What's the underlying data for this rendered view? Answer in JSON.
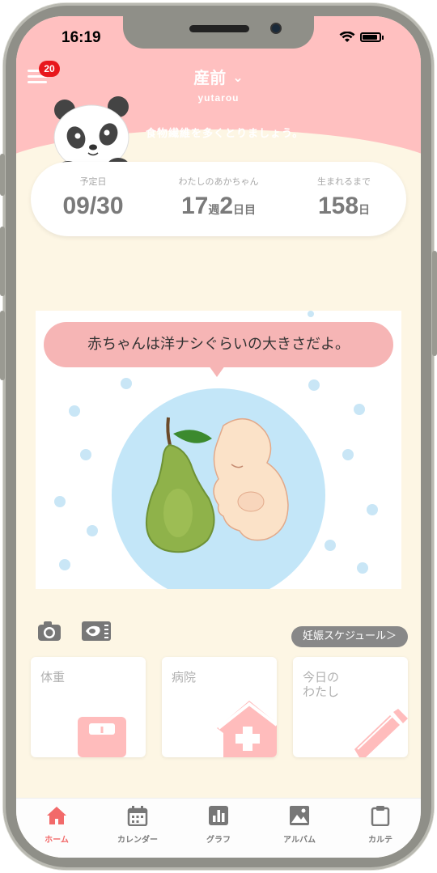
{
  "status_bar": {
    "time": "16:19"
  },
  "header": {
    "menu_badge": "20",
    "mode_title": "産前",
    "mode_chevron": "⌄",
    "username": "yutarou",
    "advice": "食物繊維を多くとりましょう。",
    "mascot": "panda-mascot"
  },
  "info": {
    "due": {
      "label": "予定日",
      "value": "09/30"
    },
    "baby": {
      "label": "わたしのあかちゃん",
      "weeks": "17",
      "weeks_unit": "週",
      "days": "2",
      "days_unit": "日目"
    },
    "remaining": {
      "label": "生まれるまで",
      "value": "158",
      "unit": "日"
    }
  },
  "baby_size": {
    "message": "赤ちゃんは洋ナシぐらいの大きさだよ。",
    "illustration": "pear-and-fetus"
  },
  "tools": {
    "camera_icon": "camera-icon",
    "echo_icon": "ultrasound-icon",
    "schedule_label": "妊娠スケジュール＞"
  },
  "tiles": [
    {
      "label": "体重",
      "icon": "scale-icon"
    },
    {
      "label": "病院",
      "icon": "hospital-icon"
    },
    {
      "label": "今日の\nわたし",
      "icon": "pencil-icon"
    }
  ],
  "tabs": [
    {
      "label": "ホーム",
      "icon": "home-icon",
      "active": true
    },
    {
      "label": "カレンダー",
      "icon": "calendar-icon",
      "active": false
    },
    {
      "label": "グラフ",
      "icon": "graph-icon",
      "active": false
    },
    {
      "label": "アルバム",
      "icon": "album-icon",
      "active": false
    },
    {
      "label": "カルテ",
      "icon": "clipboard-icon",
      "active": false
    }
  ],
  "colors": {
    "header_pink": "#ffc0c0",
    "background_cream": "#fdf6e4",
    "accent_pink": "#f26a6a",
    "tile_icon_pink": "#ffbcbc",
    "badge_red": "#e8171c"
  }
}
